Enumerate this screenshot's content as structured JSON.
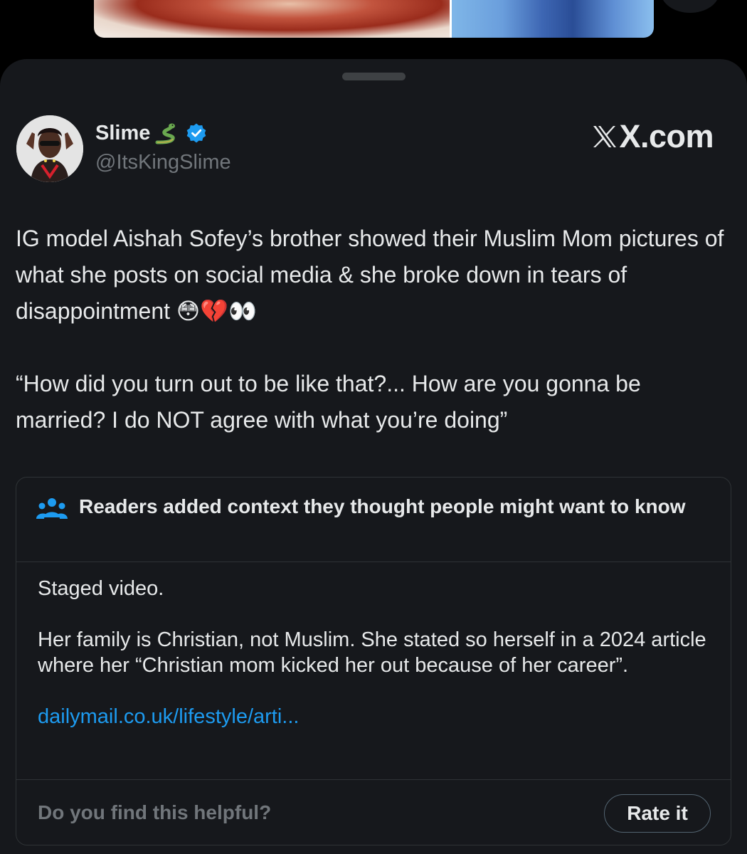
{
  "author": {
    "name": "Slime",
    "handle": "@ItsKingSlime",
    "verified": true,
    "badge_emoji": "snake-icon"
  },
  "brand": {
    "label": "X.com"
  },
  "post": {
    "text": "IG model Aishah Sofey’s brother showed their Muslim Mom pictures of what she posts on social media & she broke down in tears of disappointment 😳💔👀",
    "quote": "“How did you turn out to be like that?... How are you gonna be married? I do NOT agree with what you’re doing”"
  },
  "note": {
    "title": "Readers added context they thought people might want to know",
    "body_1": "Staged video.",
    "body_2": "Her family is Christian, not Muslim. She stated so herself in a 2024 article where her “Christian mom kicked her out because of her career”.",
    "link_text": "dailymail.co.uk/lifestyle/arti...",
    "helpful_prompt": "Do you find this helpful?",
    "rate_label": "Rate it"
  },
  "colors": {
    "background": "#000000",
    "sheet": "#16181c",
    "text_primary": "#e7e9ea",
    "text_secondary": "#71767b",
    "link": "#1d9bf0",
    "verified": "#1d9bf0",
    "border": "#2f3336"
  }
}
